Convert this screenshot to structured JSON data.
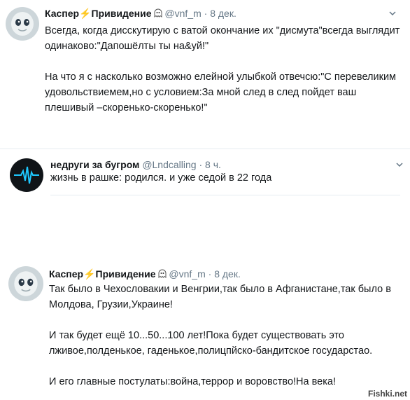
{
  "tweets": [
    {
      "name_part1": "Каспер",
      "name_part2": "Привидение",
      "handle": "@vnf_m",
      "separator": "·",
      "time": "8 дек.",
      "text": "Всегда, когда дисскутирую с ватой окончание их \"дисмута\"всегда выглядит одинаково:\"Дапошёлты ты на&уй!\"\n\nНа что я с насколько возможно елейной улыбкой отвечсю:\"С перевеликим удовольствиемем,но с условием:За мной след  в след пойдет ваш плешивый –скоренько-скоренько!\""
    },
    {
      "name": "недруги за бугром",
      "handle": "@Lndcalling",
      "separator": "·",
      "time": "8 ч.",
      "text": "жизнь в рашке: родился. и уже седой в 22 года"
    },
    {
      "name_part1": "Каспер",
      "name_part2": "Привидение",
      "handle": "@vnf_m",
      "separator": "·",
      "time": "8 дек.",
      "text": "Так было в Чехословакии и Венгрии,так было в Афганистане,так было в Молдова, Грузии,Украине!\n\nИ так будет ещё 10...50...100 лет!Пока будет существовать это лживое,полденькое, гаденькое,полицпйско-бандитское государстао.\n\nИ его главные постулаты:война,террор и воровство!На века!"
    }
  ],
  "watermark": "Fishki.net",
  "colors": {
    "accent": "#f5a623",
    "muted": "#657786",
    "text": "#14171a"
  }
}
